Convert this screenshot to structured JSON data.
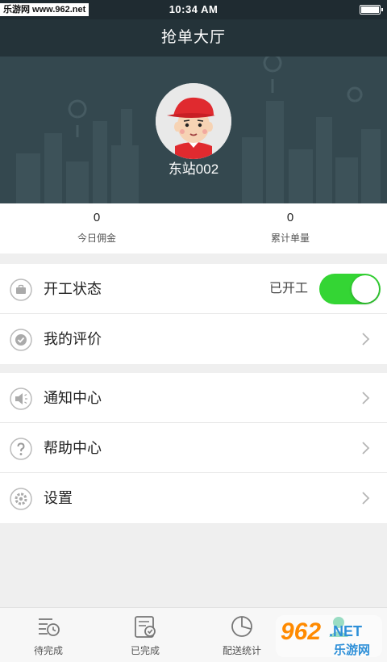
{
  "status_bar": {
    "carrier": "乐游网 www.962.net",
    "time": "10:34 AM",
    "battery_icon": "battery-icon"
  },
  "nav": {
    "title": "抢单大厅"
  },
  "profile": {
    "avatar_icon": "courier-avatar",
    "username": "东站002"
  },
  "stats": [
    {
      "value": "0",
      "label": "今日佣金"
    },
    {
      "value": "0",
      "label": "累计单量"
    }
  ],
  "menu_group_1": [
    {
      "label": "开工状态",
      "icon": "briefcase-icon",
      "status_text": "已开工",
      "toggle_on": true
    },
    {
      "label": "我的评价",
      "icon": "check-badge-icon"
    }
  ],
  "menu_group_2": [
    {
      "label": "通知中心",
      "icon": "speaker-icon"
    },
    {
      "label": "帮助中心",
      "icon": "question-icon"
    },
    {
      "label": "设置",
      "icon": "gear-icon"
    }
  ],
  "tabs": [
    {
      "label": "待完成",
      "icon": "list-clock-icon"
    },
    {
      "label": "已完成",
      "icon": "list-check-icon"
    },
    {
      "label": "配送统计",
      "icon": "pie-chart-icon"
    },
    {
      "label": "",
      "icon": "profile-icon",
      "active": true
    }
  ],
  "watermark": {
    "brand_number": "962",
    "brand_suffix": ".NET",
    "brand_name": "乐游网"
  },
  "colors": {
    "header": "#243339",
    "hero": "#34484f",
    "toggle_on": "#34d534",
    "avatar_cap": "#e02a2f"
  }
}
